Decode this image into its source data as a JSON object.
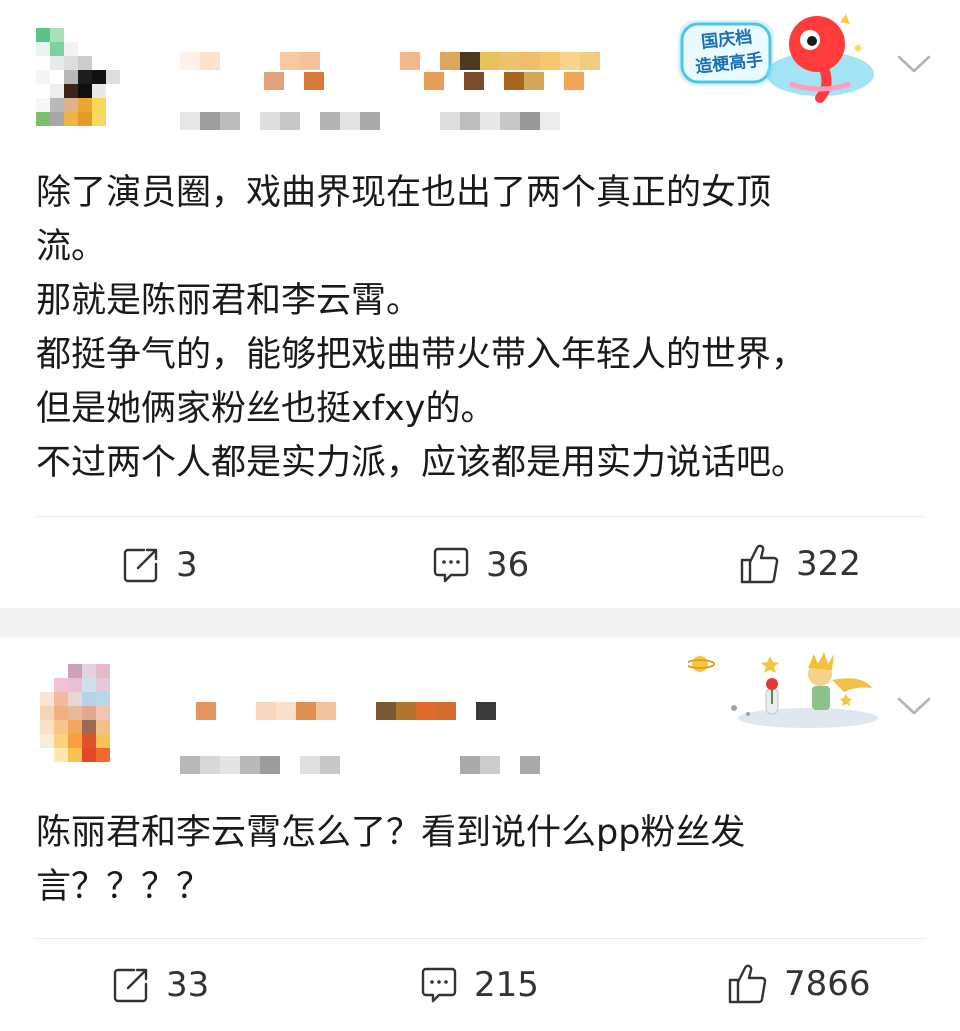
{
  "posts": [
    {
      "content_lines": [
        "除了演员圈，戏曲界现在也出了两个真正的女顶",
        "流。",
        "那就是陈丽君和李云霄。",
        "都挺争气的，能够把戏曲带火带入年轻人的世界，",
        "但是她俩家粉丝也挺xfxy的。",
        "不过两个人都是实力派，应该都是用实力说话吧。"
      ],
      "badge_text": "国庆档\n造梗高手",
      "actions": {
        "repost": "3",
        "comment": "36",
        "like": "322"
      }
    },
    {
      "content_lines": [
        "陈丽君和李云霄怎么了？看到说什么pp粉丝发",
        "言？？？？"
      ],
      "actions": {
        "repost": "33",
        "comment": "215",
        "like": "7866"
      }
    }
  ],
  "icons": {
    "repost": "repost-icon",
    "comment": "comment-icon",
    "like": "thumbs-up-icon",
    "chevron": "chevron-down-icon"
  },
  "colors": {
    "text": "#1a1a1a",
    "count": "#333333",
    "icon": "#333333",
    "separator": "#f2f2f2",
    "divider": "#ececec"
  }
}
